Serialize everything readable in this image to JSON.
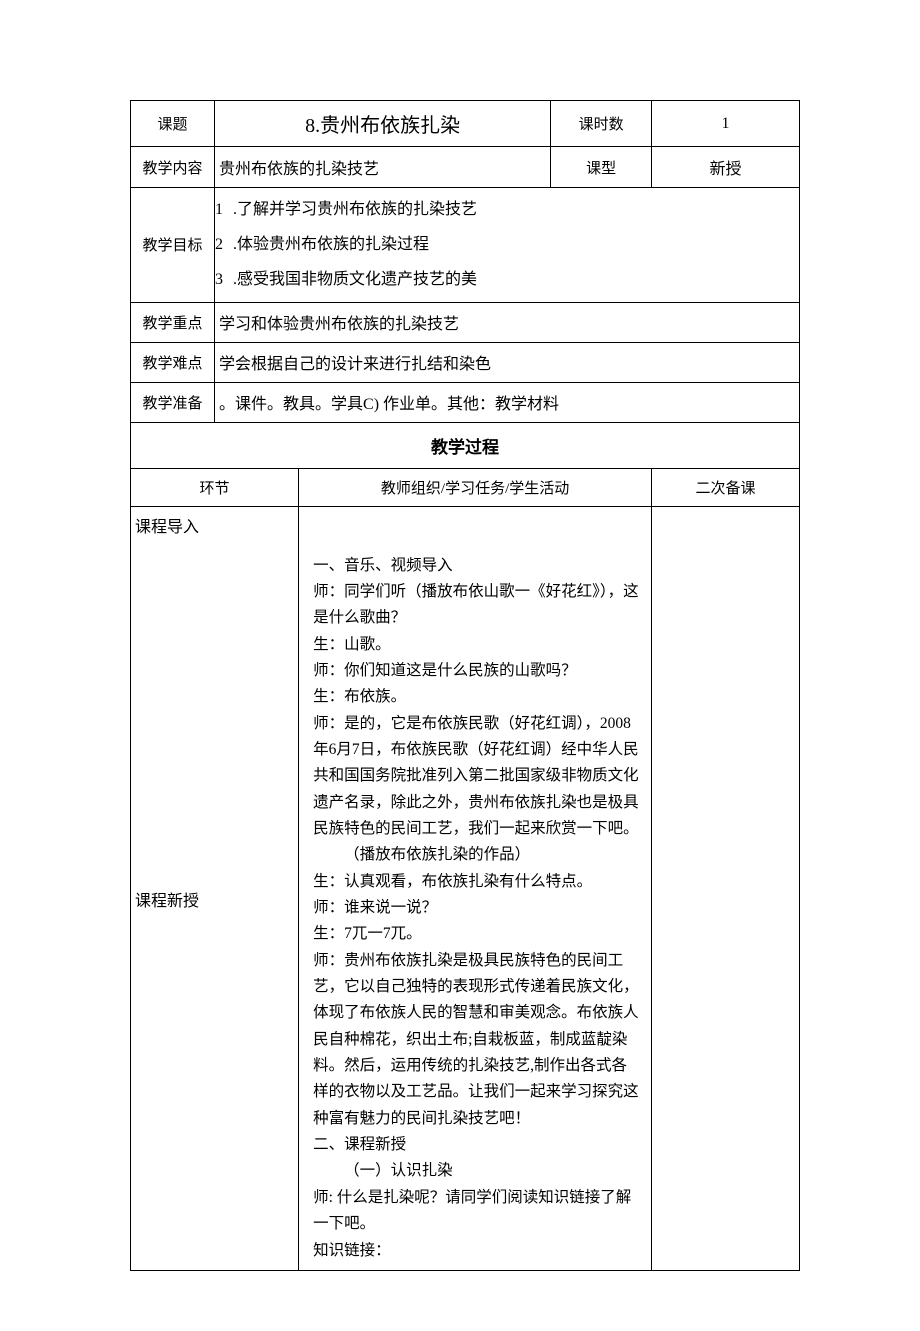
{
  "labels": {
    "topic": "课题",
    "hours": "课时数",
    "content": "教学内容",
    "type": "课型",
    "goals": "教学目标",
    "keypoint": "教学重点",
    "difficulty": "教学难点",
    "prep": "教学准备",
    "process": "教学过程",
    "segment": "环节",
    "activities": "教师组织/学习任务/学生活动",
    "secondary": "二次备课"
  },
  "values": {
    "topic": "8.贵州布依族扎染",
    "hours": "1",
    "content": "贵州布依族的扎染技艺",
    "type": "新授",
    "goals": [
      "1",
      ".了解并学习贵州布依族的扎染技艺",
      "2",
      ".体验贵州布依族的扎染过程",
      "3",
      ".感受我国非物质文化遗产技艺的美"
    ],
    "keypoint": "学习和体验贵州布依族的扎染技艺",
    "difficulty": "学会根据自己的设计来进行扎结和染色",
    "prep": "。课件。教具。学具C) 作业单。其他：教学材料"
  },
  "segments": {
    "intro": "课程导入",
    "new": "课程新授"
  },
  "body": [
    "一、音乐、视频导入",
    "师：同学们听（播放布依山歌一《好花红》），这是什么歌曲？",
    "生：山歌。",
    "师：你们知道这是什么民族的山歌吗？",
    "生：布依族。",
    "师：是的，它是布依族民歌（好花红调），2008年6月7日，布依族民歌（好花红调）经中华人民共和国国务院批准列入第二批国家级非物质文化遗产名录，除此之外，贵州布依族扎染也是极具民族特色的民间工艺，我们一起来欣赏一下吧。",
    "（播放布依族扎染的作品）",
    "生：认真观看，布依族扎染有什么特点。",
    "师：谁来说一说？",
    "生：7兀一7兀。",
    "师：贵州布依族扎染是极具民族特色的民间工艺，它以自己独特的表现形式传递着民族文化，体现了布依族人民的智慧和审美观念。布依族人民自种棉花，织出土布;自栽板蓝，制成蓝靛染料。然后，运用传统的扎染技艺,制作出各式各样的衣物以及工艺品。让我们一起来学习探究这种富有魅力的民间扎染技艺吧！",
    "二、课程新授",
    "（一）认识扎染",
    "师: 什么是扎染呢？请同学们阅读知识链接了解一下吧。",
    "知识链接："
  ]
}
